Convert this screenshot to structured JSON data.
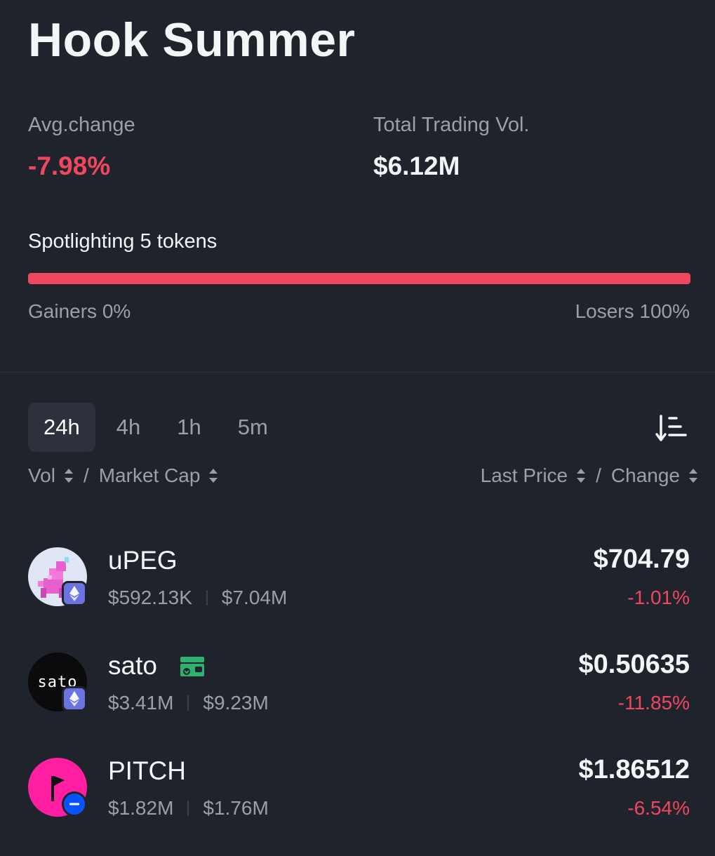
{
  "header": {
    "title": "Hook Summer"
  },
  "stats": {
    "avg_change_label": "Avg.change",
    "avg_change_value": "-7.98%",
    "total_vol_label": "Total Trading Vol.",
    "total_vol_value": "$6.12M"
  },
  "spotlight": {
    "label": "Spotlighting 5 tokens",
    "losers_fraction": 1.0,
    "gainers_label": "Gainers 0%",
    "losers_label": "Losers 100%"
  },
  "tabs": [
    {
      "label": "24h",
      "active": true
    },
    {
      "label": "4h",
      "active": false
    },
    {
      "label": "1h",
      "active": false
    },
    {
      "label": "5m",
      "active": false
    }
  ],
  "columns": {
    "vol": "Vol",
    "slash": "/",
    "market_cap": "Market Cap",
    "last_price": "Last Price",
    "change": "Change"
  },
  "tokens": [
    {
      "name": "uPEG",
      "vol": "$592.13K",
      "mcap": "$7.04M",
      "price": "$704.79",
      "change": "-1.01%",
      "chain": "ethereum-icon"
    },
    {
      "name": "sato",
      "logo_text": "sato",
      "vol": "$3.41M",
      "mcap": "$9.23M",
      "price": "$0.50635",
      "change": "-11.85%",
      "chain": "ethereum-icon"
    },
    {
      "name": "PITCH",
      "vol": "$1.82M",
      "mcap": "$1.76M",
      "price": "$1.86512",
      "change": "-6.54%",
      "chain": "base-icon"
    }
  ],
  "colors": {
    "negative": "#f0475f",
    "background": "#1f232c",
    "accent_green": "#2fb170"
  }
}
